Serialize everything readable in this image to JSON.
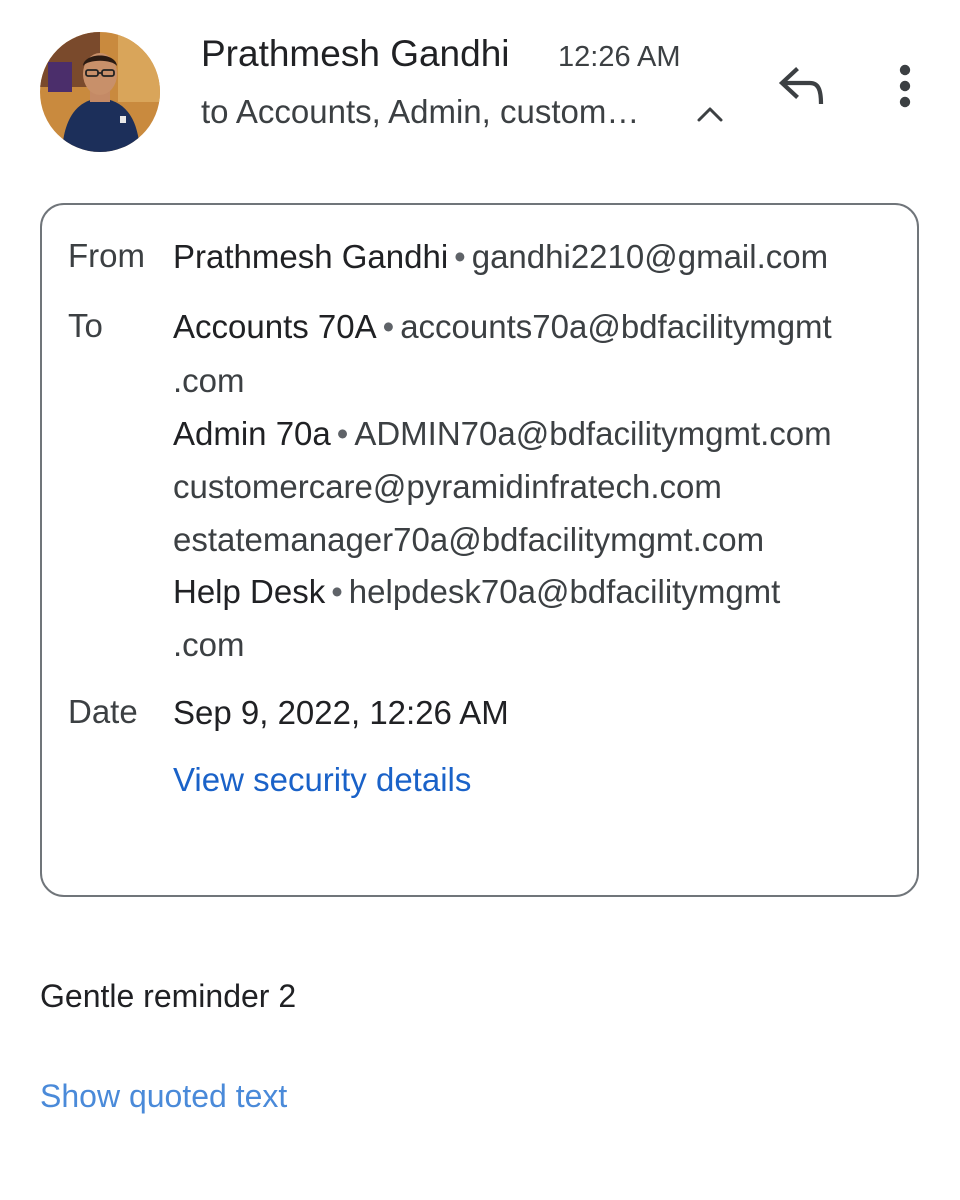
{
  "header": {
    "sender_name": "Prathmesh Gandhi",
    "time": "12:26 AM",
    "recipients_summary": "to Accounts, Admin, custom…"
  },
  "details": {
    "from_label": "From",
    "from_name": "Prathmesh Gandhi",
    "from_email": "gandhi2210@gmail.com",
    "to_label": "To",
    "to": [
      {
        "name": "Accounts 70A",
        "email_line1": "accounts70a@bdfacilitymgmt",
        "email_line2": ".com"
      },
      {
        "name": "Admin 70a",
        "email": "ADMIN70a@bdfacilitymgmt.com"
      },
      {
        "email": "customercare@pyramidinfratech.com"
      },
      {
        "email": "estatemanager70a@bdfacilitymgmt.com"
      },
      {
        "name": "Help Desk",
        "email_line1": "helpdesk70a@bdfacilitymgmt",
        "email_line2": ".com"
      }
    ],
    "separator": "•",
    "date_label": "Date",
    "date_value": "Sep 9, 2022, 12:26 AM",
    "security_link": "View security details"
  },
  "body": {
    "text": "Gentle reminder 2",
    "show_quoted": "Show quoted text"
  },
  "icons": {
    "expand": "chevron-up-icon",
    "reply": "reply-icon",
    "more": "more-vert-icon"
  },
  "colors": {
    "link": "#1a62c8",
    "quoted_link": "#4a8ad9",
    "card_border": "#70757a",
    "primary_text": "#202124",
    "secondary_text": "#3c4043"
  }
}
